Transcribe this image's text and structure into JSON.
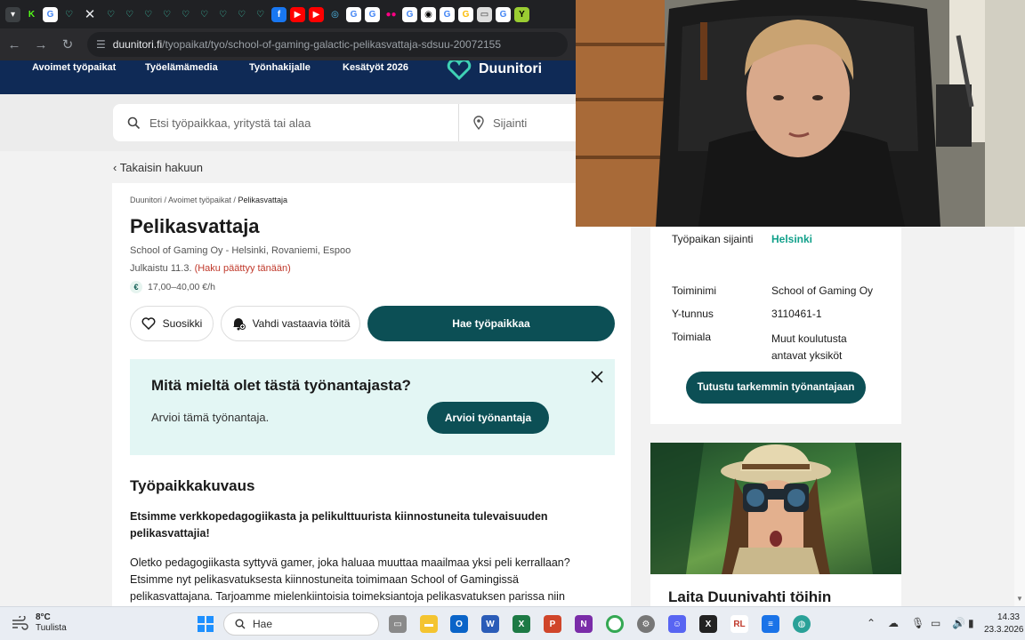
{
  "browser": {
    "url_domain": "duunitori.fi",
    "url_path": "/tyopaikat/tyo/school-of-gaming-galactic-pelikasvattaja-sdsuu-20072155"
  },
  "topnav": {
    "items": [
      "Avoimet työpaikat",
      "Työelämämedia",
      "Työnhakijalle",
      "Kesätyöt 2026"
    ],
    "logo": "Duunitori"
  },
  "search": {
    "query_placeholder": "Etsi työpaikkaa, yritystä tai alaa",
    "location_placeholder": "Sijainti"
  },
  "back_link": "Takaisin hakuun",
  "job": {
    "breadcrumb": [
      "Duunitori",
      "Avoimet työpaikat",
      "Pelikasvattaja"
    ],
    "title": "Pelikasvattaja",
    "company_line": "School of Gaming Oy - Helsinki, Rovaniemi, Espoo",
    "published": "Julkaistu 11.3.",
    "ends": "(Haku päättyy tänään)",
    "salary": "17,00–40,00 €/h",
    "favorite_label": "Suosikki",
    "watch_label": "Vahdi vastaavia töitä",
    "apply_label": "Hae työpaikkaa"
  },
  "feedback": {
    "title": "Mitä mieltä olet tästä työnantajasta?",
    "text": "Arvioi tämä työnantaja.",
    "button": "Arvioi työnantaja"
  },
  "description": {
    "heading": "Työpaikkakuvaus",
    "lead": "Etsimme verkkopedagogiikasta ja pelikulttuurista kiinnostuneita tulevaisuuden pelikasvattajia!",
    "body": "Oletko pedagogiikasta syttyvä gamer, joka haluaa muuttaa maailmaa yksi peli kerrallaan? Etsimme nyt pelikasvatuksesta kiinnostuneita toimimaan School of Gamingissä pelikasvattajana. Tarjoamme mielenkiintoisia toimeksiantoja pelikasvatuksen parissa niin"
  },
  "sidebar": {
    "location_label": "Työpaikan sijainti",
    "location_value": "Helsinki",
    "company_label": "Toiminimi",
    "company_value": "School of Gaming Oy",
    "ytunnus_label": "Y-tunnus",
    "ytunnus_value": "3110461-1",
    "industry_label": "Toimiala",
    "industry_value": "Muut koulutusta antavat yksiköt",
    "employer_button": "Tutustu tarkemmin työnantajaan",
    "promo_title": "Laita Duunivahti töihin"
  },
  "taskbar": {
    "temperature": "8°C",
    "weather": "Tuulista",
    "search_label": "Hae",
    "time": "14.33",
    "date": "23.3.2026"
  },
  "colors": {
    "navy": "#0f2a56",
    "teal_button": "#0c4f55",
    "feedback_bg": "#e3f6f4",
    "deadline_red": "#c0392b",
    "location_green": "#11a08a"
  }
}
